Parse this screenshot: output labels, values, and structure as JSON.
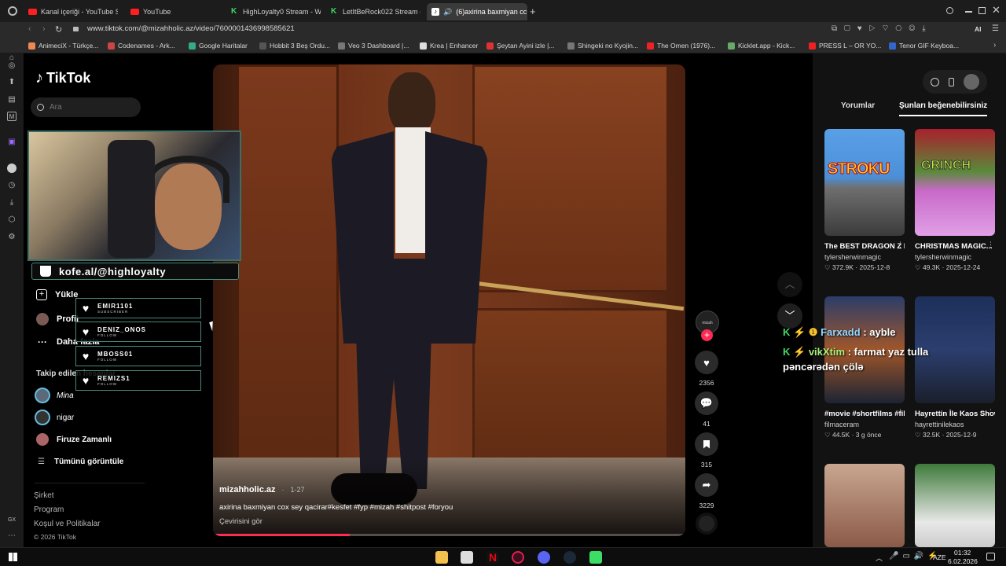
{
  "browser": {
    "tabs": [
      {
        "label": "Kanal içeriği - YouTube St",
        "fav": "youtube-icon"
      },
      {
        "label": "YouTube",
        "fav": "youtube-icon"
      },
      {
        "label": "HighLoyalty0 Stream - Wa",
        "fav": "kick-icon"
      },
      {
        "label": "LetItBeRock022 Stream -",
        "fav": "kick-icon"
      },
      {
        "label": "(6)axirina baxmiyan cc",
        "fav": "tiktok-icon"
      }
    ],
    "new_tab": "+",
    "url": "www.tiktok.com/@mizahholic.az/video/7600001436998585621",
    "bookmarks": [
      "AnimeciX - Türkçe...",
      "Codenames - Ark...",
      "Google Haritalar",
      "Hobbit 3 Beş Ordu...",
      "Veo 3 Dashboard |...",
      "Krea | Enhancer",
      "Şeytan Ayini izle |...",
      "Shingeki no Kyojin...",
      "The Omen (1976)...",
      "Kicklet.app - Kick...",
      "PRESS L – OR YO...",
      "Tenor GIF Keyboa..."
    ],
    "ai_label": "AI"
  },
  "tiktok": {
    "logo": "TikTok",
    "search_placeholder": "Ara",
    "nav": {
      "upload": "Yükle",
      "profile": "Profil",
      "more": "Daha fazla"
    },
    "following_header": "Takip edilen hesaplar",
    "following": [
      {
        "name": "Mina"
      },
      {
        "name": "nigar"
      },
      {
        "name": "Firuze Zamanlı"
      }
    ],
    "see_all": "Tümünü görüntüle",
    "footer": [
      "Şirket",
      "Program",
      "Koşul ve Politikalar",
      "© 2026 TikTok"
    ],
    "video": {
      "author": "mizahholic.az",
      "date": "1-27",
      "caption": "axirina baxmiyan cox sey qacirar#kesfet #fyp #mizah #shitpost #foryou",
      "translate": "Çevirisini gör",
      "progress": 0.29
    },
    "actions": {
      "likes": "2356",
      "comments": "41",
      "saves": "315",
      "shares": "3229"
    },
    "right_tabs": {
      "comments": "Yorumlar",
      "suggested": "Şunları beğenebilirsiniz"
    },
    "cards": [
      {
        "title": "The BEST DRAGON Z BALL...",
        "author": "tylersherwinmagic",
        "views": "372.9K",
        "date": "2025-12-8",
        "thumb_text": "STROKU"
      },
      {
        "title": "CHRISTMAS MAGIC...",
        "author": "tylersherwinmagic",
        "views": "49.3K",
        "date": "2025-12-24",
        "thumb_text": "GRINCH"
      },
      {
        "title": "#movie #shortfilms #films",
        "author": "filmaceram",
        "views": "44.5K",
        "date": "3 g önce",
        "thumb_text": ""
      },
      {
        "title": "Hayrettin İle Kaos Show 3. Bölüm...",
        "author": "hayrettinilekaos",
        "views": "32.5K",
        "date": "2025-12-9",
        "thumb_text": ""
      },
      {
        "title": "",
        "author": "",
        "views": "",
        "date": "",
        "thumb_text": ""
      },
      {
        "title": "",
        "author": "",
        "views": "",
        "date": "",
        "thumb_text": ""
      }
    ]
  },
  "overlay": {
    "kofe": "kofe.al/@highloyalty",
    "events": [
      {
        "name": "EMIR1101",
        "type": "SUBSCRIBER"
      },
      {
        "name": "DENIZ_ONOS",
        "type": "FOLLOW"
      },
      {
        "name": "MBOSS01",
        "type": "FOLLOW"
      },
      {
        "name": "REMIZS1",
        "type": "FOLLOW"
      }
    ],
    "chat": [
      {
        "user": "Farxadd",
        "text": ": ayble"
      },
      {
        "user": "vikXtim",
        "text": ": farmat yaz tulla pəncərədən çölə"
      }
    ]
  },
  "taskbar": {
    "lang": "AZE",
    "time": "01:32",
    "date": "6.02.2026"
  },
  "colors": {
    "accent": "#fe2c55",
    "chat_user_farxadd": "#8fd6ff",
    "chat_user_vik": "#a6f07a",
    "overlay_teal": "#4a8a7d"
  }
}
